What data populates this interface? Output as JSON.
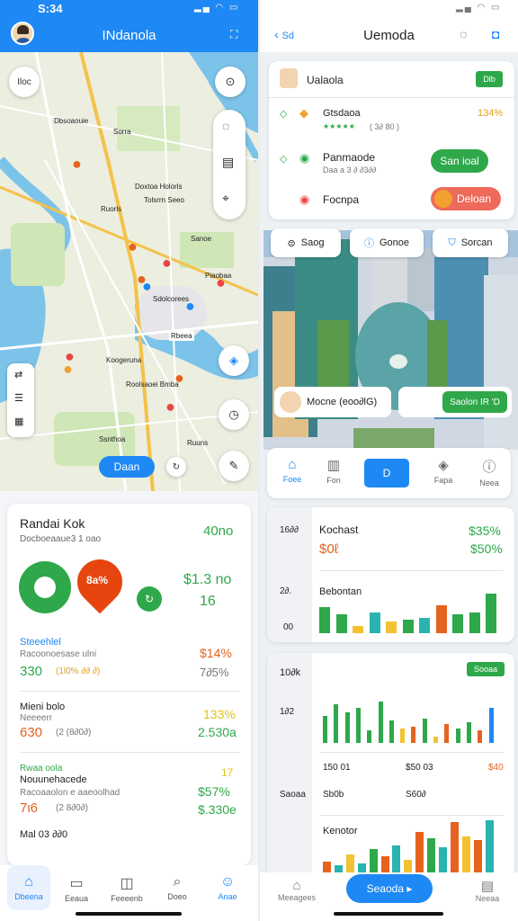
{
  "left": {
    "status": {
      "time": "S:34",
      "icons": "▂▄ ◠ ▭"
    },
    "header": {
      "title": "INdanola",
      "menu_icon": "grid-icon"
    },
    "map": {
      "labels": [
        "Iloc",
        "Dbsoaouie",
        "Sorra",
        "Doxtoa Holorls",
        "Tolsrrn Seeo",
        "Ruorls",
        "Sanoe",
        "Piaobaa",
        "Sdolcorees",
        "Rbeea",
        "Koogeruna",
        "Roolsaoei Bmba",
        "Ssnthoa",
        "Ruuns"
      ],
      "search_button": "Daan"
    },
    "summary": {
      "title": "Randai Kok",
      "subtitle": "Docboeaaue3 1 oao",
      "value": "40no",
      "big_pin": "8a%",
      "side_value1": "$1.3 no",
      "side_value2": "16",
      "stats": [
        {
          "label": "Steeehlel",
          "sub": "Racoonoesase ulni",
          "value": "330",
          "detail": "(1l0%  ∂∂ ∂)",
          "right_top": "$14%",
          "right_bottom": "7∂5%"
        },
        {
          "label": "Mieni  bolo",
          "sub": "Neeeerr",
          "value": "630",
          "detail": "(2  (8∂0∂)",
          "right_top": "133%",
          "right_bottom": "2.530a"
        },
        {
          "label": "Rwaa oola",
          "label2": "Nouunehacede",
          "sub": "Racoaaolon e aaeoolhad",
          "value": "7ι6",
          "detail": "(2  8∂0∂)",
          "right_top": "17",
          "right_middle": "$57%",
          "right_bottom": "$.330e"
        }
      ],
      "footer": "Mal 03 ∂∂0"
    },
    "nav": [
      "Dbeena",
      "Eeaua",
      "Feeeenb",
      "Doeo",
      "Anae"
    ]
  },
  "right": {
    "status": {
      "icons": "▂▄ ◠ ▭"
    },
    "header": {
      "back_label": "Sd",
      "title": "Uemoda"
    },
    "list": {
      "user_name": "Ualaola",
      "badge": "Dlb",
      "items": [
        {
          "name": "Gtsdaoa",
          "stars": "★★★★★",
          "meta": "( 3∂ 80 )",
          "value": "134%"
        },
        {
          "name": "Panmaode",
          "meta": "Daa a 3 ∂ ∂3∂∂",
          "action": "San ioal"
        },
        {
          "name": "Focnpa",
          "action": "Deloan"
        }
      ]
    },
    "chips": [
      "Saog",
      "Gonoe",
      "Sorcan"
    ],
    "photo": {
      "user_label": "Mocne  (eoo∂lG)",
      "action": "Saolon IR 'D"
    },
    "tabs": [
      "Foee",
      "Fon",
      "D",
      "Fapa",
      "Neea"
    ],
    "chart1": {
      "y_labels": [
        "16∂∂",
        "2∂.",
        "00"
      ],
      "name": "Kochast",
      "value": "$0ℓ",
      "right_top": "$35%",
      "right_bottom": "$50%",
      "sub": "Bebontan"
    },
    "chart2": {
      "top_label": "10∂k",
      "badge": "Sooaa",
      "y1": "1∂2",
      "row1": [
        "150 01",
        "$50 03",
        "$40"
      ],
      "row2": [
        "Saoaa",
        "Sb0b",
        "S60∂"
      ],
      "sub": "Kenotor"
    },
    "bottom": {
      "left": "Meeagees",
      "button": "Seaoda ▸",
      "right": "Neeaa"
    }
  },
  "chart_data": [
    {
      "type": "bar",
      "title": "Kochast",
      "series": [
        {
          "values": [
            28,
            20,
            8,
            22,
            12,
            14,
            16,
            30,
            20,
            22,
            42
          ]
        }
      ]
    },
    {
      "type": "bar",
      "title": "",
      "series": [
        {
          "values": [
            26,
            38,
            30,
            34,
            12,
            40,
            22,
            14,
            16,
            24,
            6,
            18,
            14,
            20,
            12,
            34
          ]
        }
      ]
    },
    {
      "type": "bar",
      "title": "Kenotor",
      "series": [
        {
          "values": [
            12,
            8,
            20,
            10,
            26,
            18,
            30,
            14,
            45,
            38,
            28,
            56,
            40,
            36,
            58
          ]
        }
      ]
    }
  ],
  "colors": {
    "blue": "#1e88f5",
    "green": "#2ea84a",
    "orange": "#e6621f",
    "yellow": "#f2c230",
    "teal": "#2bb3b1"
  }
}
